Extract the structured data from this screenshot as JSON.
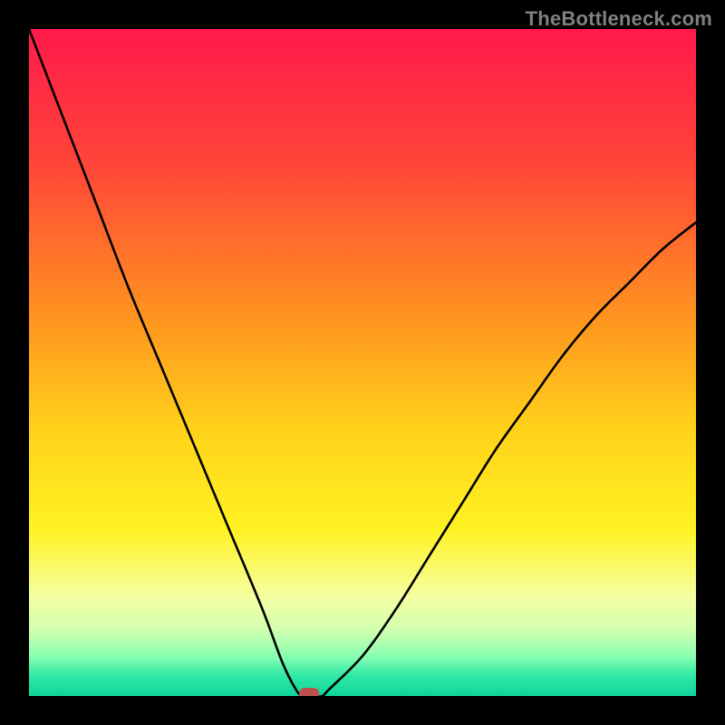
{
  "watermark": "TheBottleneck.com",
  "chart_data": {
    "type": "line",
    "title": "",
    "xlabel": "",
    "ylabel": "",
    "xlim": [
      0,
      100
    ],
    "ylim": [
      0,
      100
    ],
    "series": [
      {
        "name": "curve",
        "x": [
          0,
          5,
          10,
          15,
          20,
          25,
          30,
          35,
          38,
          40,
          41,
          42,
          43,
          44,
          45,
          50,
          55,
          60,
          65,
          70,
          75,
          80,
          85,
          90,
          95,
          100
        ],
        "y": [
          100,
          87,
          74,
          61,
          49,
          37,
          25,
          13,
          5,
          1,
          0,
          0,
          0,
          0,
          1,
          6,
          13,
          21,
          29,
          37,
          44,
          51,
          57,
          62,
          67,
          71
        ]
      }
    ],
    "marker": {
      "x": 42,
      "y": 0
    },
    "background_gradient": {
      "stops": [
        {
          "pos": 0.0,
          "color": "#ff1a4b"
        },
        {
          "pos": 0.2,
          "color": "#ff4438"
        },
        {
          "pos": 0.45,
          "color": "#ff9a1e"
        },
        {
          "pos": 0.6,
          "color": "#ffd21a"
        },
        {
          "pos": 0.75,
          "color": "#fff222"
        },
        {
          "pos": 0.85,
          "color": "#f5ffa0"
        },
        {
          "pos": 0.9,
          "color": "#d2ffb0"
        },
        {
          "pos": 0.94,
          "color": "#8affb0"
        },
        {
          "pos": 0.97,
          "color": "#30e9a6"
        },
        {
          "pos": 1.0,
          "color": "#10d49c"
        }
      ]
    }
  }
}
